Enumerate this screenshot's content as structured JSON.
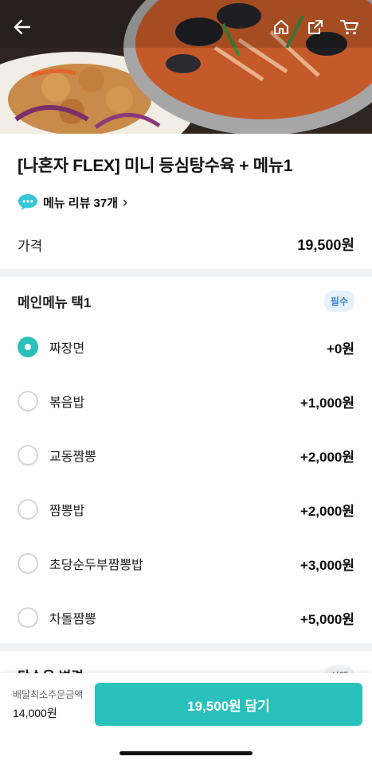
{
  "header": {
    "back_icon": "arrow-left-icon",
    "home_icon": "home-icon",
    "share_icon": "share-icon",
    "cart_icon": "cart-icon"
  },
  "menu": {
    "title": "[나혼자 FLEX] 미니 등심탕수육 + 메뉴1",
    "review_label": "메뉴 리뷰 37개",
    "review_chevron": "›",
    "price_label": "가격",
    "price_value": "19,500원"
  },
  "options": {
    "title": "메인메뉴 택1",
    "badge": "필수",
    "selected_index": 0,
    "items": [
      {
        "name": "짜장면",
        "price": "+0원"
      },
      {
        "name": "볶음밥",
        "price": "+1,000원"
      },
      {
        "name": "교동짬뽕",
        "price": "+2,000원"
      },
      {
        "name": "짬뽕밥",
        "price": "+2,000원"
      },
      {
        "name": "초당순두부짬뽕밥",
        "price": "+3,000원"
      },
      {
        "name": "차돌짬뽕",
        "price": "+5,000원"
      }
    ]
  },
  "next_section": {
    "title": "탕수육 변경",
    "badge": "선택"
  },
  "bottom_bar": {
    "min_order_label": "배달최소주문금액",
    "min_order_value": "14,000원",
    "cta_label": "19,500원 담기"
  },
  "colors": {
    "accent": "#2ac1bc",
    "badge_bg": "#e6f1fb",
    "badge_text": "#3f86d4"
  }
}
